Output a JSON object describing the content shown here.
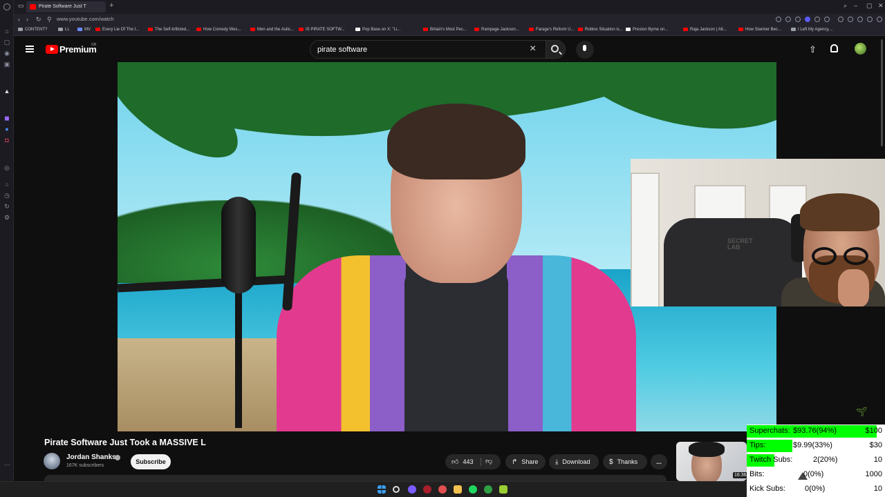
{
  "browser": {
    "tab_title": "Pirate Software Just T",
    "url": "www.youtube.com/watch",
    "bookmarks": [
      {
        "label": "CONTENT?",
        "color": "#9aa0a6"
      },
      {
        "label": "LL",
        "color": "#9aa0a6"
      },
      {
        "label": "MV",
        "color": "#6b8cff"
      },
      {
        "label": "Every Lie Of The I...",
        "color": "#ff0000"
      },
      {
        "label": "The Self-Inflicted...",
        "color": "#ff0000"
      },
      {
        "label": "How Comedy Wes...",
        "color": "#ff0000"
      },
      {
        "label": "Men and the Autis...",
        "color": "#ff0000"
      },
      {
        "label": "IS PIRATE SOFTW...",
        "color": "#ff0000"
      },
      {
        "label": "Pop Base on X: \"Li...",
        "color": "#ffffff"
      },
      {
        "label": "Britain's Most Pec...",
        "color": "#ff0000"
      },
      {
        "label": "Rampage Jackson...",
        "color": "#ff0000"
      },
      {
        "label": "Farage's Reform U...",
        "color": "#ff0000"
      },
      {
        "label": "Roblox Situation is...",
        "color": "#ff0000"
      },
      {
        "label": "Preston Byrne on...",
        "color": "#ffffff"
      },
      {
        "label": "Raja Jackson | Att...",
        "color": "#ff0000"
      },
      {
        "label": "How Starmer Bec...",
        "color": "#ff0000"
      },
      {
        "label": "I Left My Agency,...",
        "color": "#9aa0a6"
      }
    ]
  },
  "youtube": {
    "brand": "Premium",
    "region": "GB",
    "search_query": "pirate software",
    "video_title": "Pirate Software Just Took a MASSIVE L",
    "channel_name": "Jordan Shanks",
    "subscribers": "167K subscribers",
    "subscribe_label": "Subscribe",
    "like_count": "443",
    "share_label": "Share",
    "download_label": "Download",
    "thanks_label": "Thanks",
    "more_label": "...",
    "thumb_duration": "16:36"
  },
  "webcam": {
    "chair_brand_line1": "SECRET",
    "chair_brand_line2": "LAB"
  },
  "goals": [
    {
      "label": "Superchats:",
      "amount": "$93.76",
      "percent": "(94%)",
      "goal": "$100",
      "fill": 0.94
    },
    {
      "label": "Tips:",
      "amount": "$9.99",
      "percent": "(33%)",
      "goal": "$30",
      "fill": 0.33
    },
    {
      "label": "Twitch Subs:",
      "amount": "2",
      "percent": "(20%)",
      "goal": "10",
      "fill": 0.2
    },
    {
      "label": "Bits:",
      "amount": "0",
      "percent": "(0%)",
      "goal": "1000",
      "fill": 0
    },
    {
      "label": "Kick Subs:",
      "amount": "0",
      "percent": "(0%)",
      "goal": "10",
      "fill": 0
    }
  ],
  "colors": {
    "goal_fill": "#00ff00",
    "yt_red": "#ff0000"
  }
}
